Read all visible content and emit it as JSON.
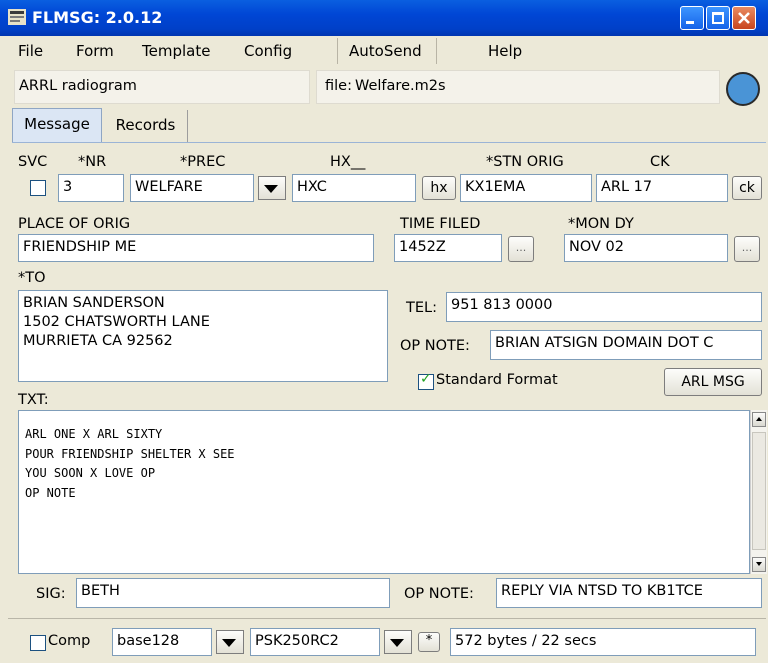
{
  "window": {
    "title": "FLMSG: 2.0.12"
  },
  "menu": {
    "file": "File",
    "form": "Form",
    "template": "Template",
    "config": "Config",
    "autosend": "AutoSend",
    "help": "Help"
  },
  "header": {
    "form_name": "ARRL radiogram",
    "file_label": "file:",
    "file_name": "Welfare.m2s",
    "status_color": "#4a94d6"
  },
  "tabs": {
    "message": "Message",
    "records": "Records"
  },
  "preamble": {
    "svc_label": "SVC",
    "nr_label": "*NR",
    "prec_label": "*PREC",
    "hx_label": "HX__",
    "stn_orig_label": "*STN ORIG",
    "ck_label": "CK",
    "nr": "3",
    "prec": "WELFARE",
    "hx": "HXC",
    "hx_button": "hx",
    "stn_orig": "KX1EMA",
    "ck": "ARL 17",
    "ck_button": "ck"
  },
  "origin": {
    "place_label": "PLACE OF ORIG",
    "place": "FRIENDSHIP ME",
    "time_label": "TIME FILED",
    "time": "1452Z",
    "mon_dy_label": "*MON DY",
    "mon_dy": "NOV 02",
    "picker_label": "..."
  },
  "to": {
    "to_label": "*TO",
    "address": "BRIAN SANDERSON\n1502 CHATSWORTH LANE\nMURRIETA CA 92562",
    "tel_label": "TEL:",
    "tel": "951 813 0000",
    "op_note_label": "OP NOTE:",
    "op_note": "BRIAN ATSIGN DOMAIN DOT C",
    "standard_format": "Standard Format",
    "arl_msg": "ARL MSG"
  },
  "text": {
    "label": "TXT:",
    "body": "ARL ONE X ARL SIXTY\nPOUR FRIENDSHIP SHELTER X SEE\nYOU SOON X LOVE OP\nOP NOTE"
  },
  "signature": {
    "sig_label": "SIG:",
    "sig": "BETH",
    "op_note_label": "OP NOTE:",
    "op_note": "REPLY VIA NTSD TO KB1TCE"
  },
  "statusbar": {
    "comp_label": "Comp",
    "encoding": "base128",
    "mode": "PSK250RC2",
    "mode_button": "*",
    "size": "572 bytes / 22 secs"
  }
}
